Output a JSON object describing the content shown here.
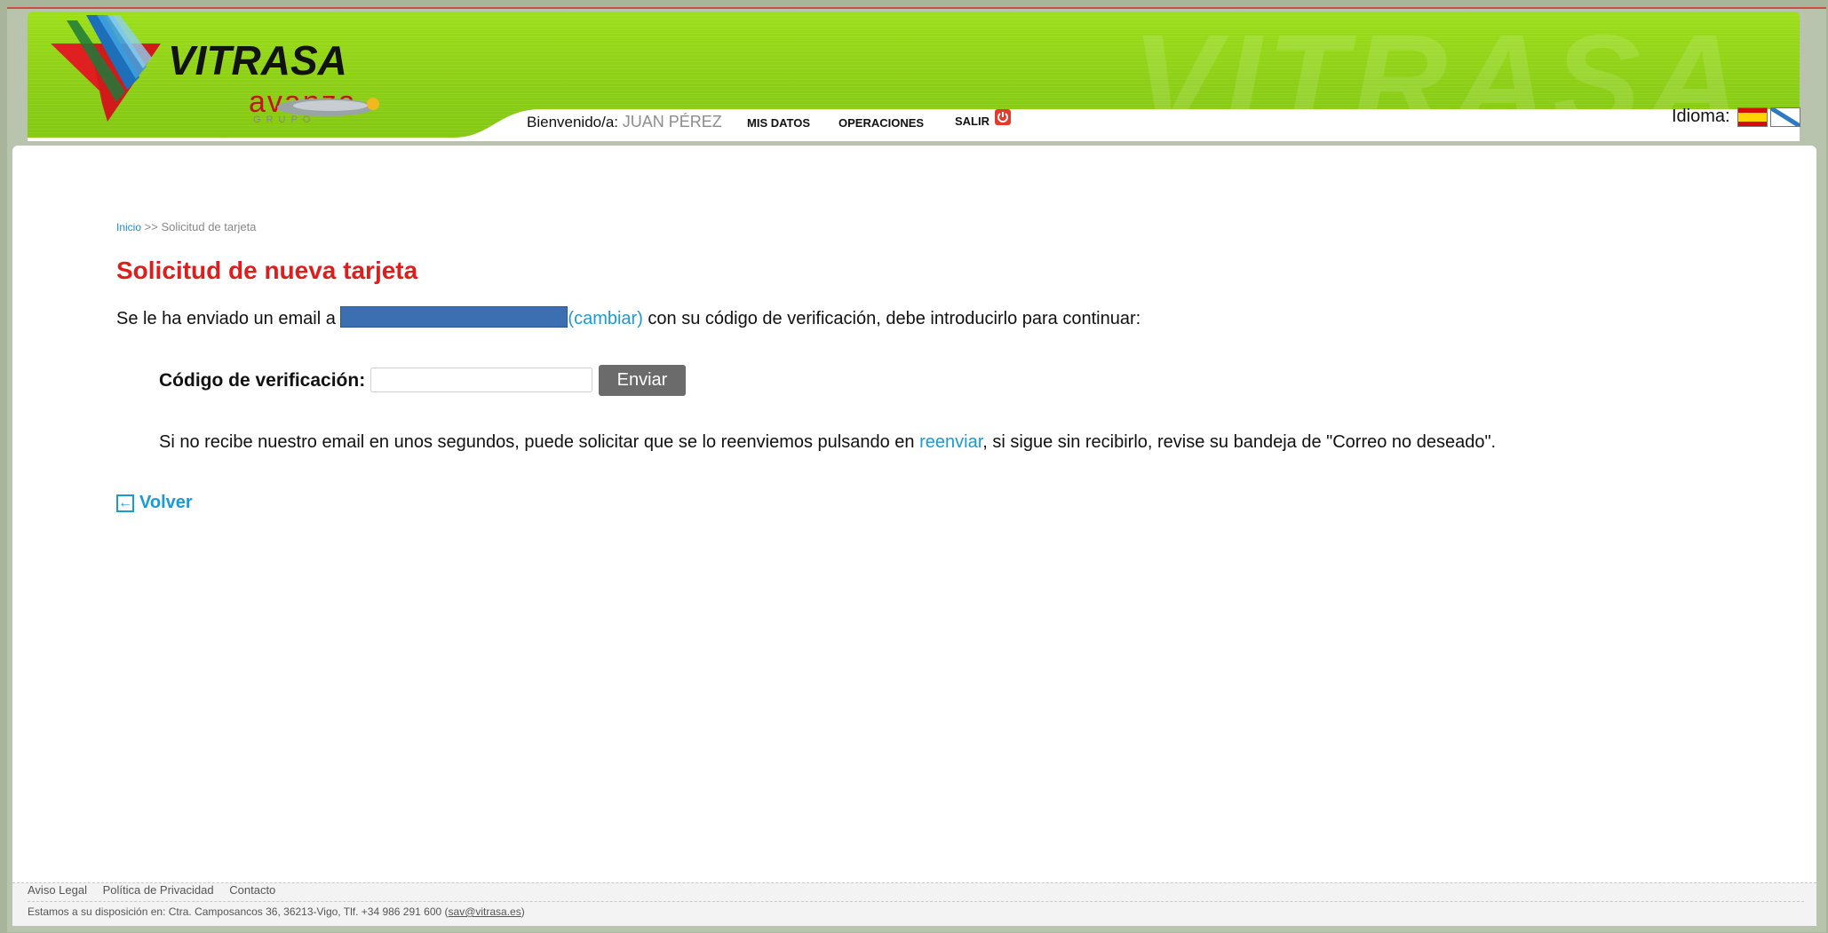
{
  "header": {
    "brand": "VITRASA",
    "brand_sub": "avanza",
    "brand_group": "GRUPO",
    "watermark": "VITRASA",
    "welcome_label": "Bienvenido/a:",
    "user_name": "JUAN PÉREZ",
    "nav": [
      "MIS DATOS",
      "OPERACIONES",
      "SALIR"
    ],
    "language_label": "Idioma:",
    "languages": [
      "Español",
      "Galego"
    ],
    "icons": {
      "logout": "power-icon"
    }
  },
  "breadcrumb": {
    "home": "Inicio",
    "separator": ">>",
    "current": "Solicitud de tarjeta"
  },
  "main": {
    "title": "Solicitud de nueva tarjeta",
    "message_prefix": "Se le ha enviado un email a",
    "change_link": "(cambiar)",
    "message_suffix": "con su código de verificación, debe introducirlo para continuar:",
    "code_label": "Código de verificación:",
    "code_value": "",
    "send_button": "Enviar",
    "resend_prefix": "Si no recibe nuestro email en unos segundos, puede solicitar que se lo reenviemos pulsando en",
    "resend_link": "reenviar",
    "resend_suffix": ", si sigue sin recibirlo, revise su bandeja de \"Correo no deseado\".",
    "back_label": "Volver"
  },
  "footer": {
    "links": [
      "Aviso Legal",
      "Política de Privacidad",
      "Contacto"
    ],
    "address": "Estamos a su disposición en: Ctra. Camposancos 36, 36213-Vigo, Tlf. +34 986 291 600 (",
    "email": "sav@vitrasa.es",
    "address_end": ")"
  },
  "colors": {
    "brand_green": "#8ccf16",
    "title_red": "#de1d1d",
    "link_blue": "#1a9ad6",
    "button_gray": "#6b6b6b"
  }
}
